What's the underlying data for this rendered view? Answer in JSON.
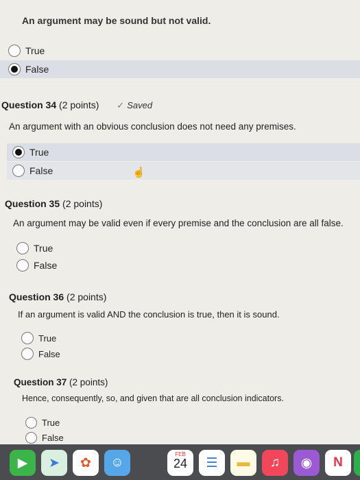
{
  "partial_question": {
    "text": "An argument may be sound but not valid."
  },
  "options": {
    "true_label": "True",
    "false_label": "False"
  },
  "questions": [
    {
      "title": "Question 34",
      "points": "(2 points)",
      "saved": "Saved",
      "text": "An argument with an obvious conclusion does not need any premises.",
      "selected": "True"
    },
    {
      "title": "Question 35",
      "points": "(2 points)",
      "text": "An argument may be valid even if every premise and the conclusion are all false.",
      "selected": ""
    },
    {
      "title": "Question 36",
      "points": "(2 points)",
      "text": "If an argument is valid AND the conclusion is true, then it is sound.",
      "selected": ""
    },
    {
      "title": "Question 37",
      "points": "(2 points)",
      "text": "Hence, consequently, so, and given that are all conclusion indicators.",
      "selected": ""
    }
  ],
  "partial_selected": "False",
  "dock": {
    "calendar_month": "FEB",
    "calendar_day": "24",
    "icons": [
      "facetime-icon",
      "maps-icon",
      "photos-icon",
      "finder-icon",
      "calendar-icon",
      "reminders-icon",
      "notes-icon",
      "music-icon",
      "podcasts-icon",
      "news-icon",
      "numbers-icon"
    ]
  }
}
